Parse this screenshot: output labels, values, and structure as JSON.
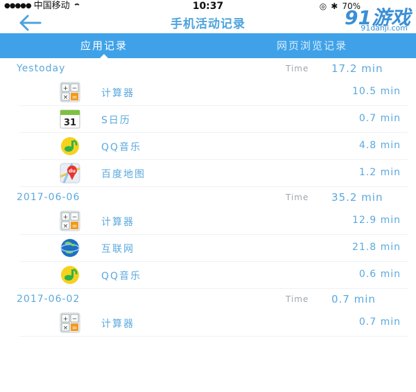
{
  "status_bar": {
    "carrier": "中国移动",
    "time": "10:37",
    "battery": "70%"
  },
  "navbar": {
    "title": "手机活动记录",
    "back_icon": "arrow-left-icon",
    "watermark_big": "91游戏",
    "watermark_small": "91danji.com"
  },
  "tabs": [
    {
      "label": "应用记录",
      "active": true
    },
    {
      "label": "网页浏览记录",
      "active": false
    }
  ],
  "time_label": "Time",
  "groups": [
    {
      "date": "Yestoday",
      "total": "17.2 min",
      "items": [
        {
          "name": "计算器",
          "duration": "10.5 min",
          "icon": "calculator-icon"
        },
        {
          "name": "S日历",
          "duration": "0.7 min",
          "icon": "calendar-icon",
          "icon_text": "31"
        },
        {
          "name": "QQ音乐",
          "duration": "4.8 min",
          "icon": "qq-music-icon"
        },
        {
          "name": "百度地图",
          "duration": "1.2 min",
          "icon": "baidu-map-icon",
          "icon_text": "du"
        }
      ]
    },
    {
      "date": "2017-06-06",
      "total": "35.2 min",
      "items": [
        {
          "name": "计算器",
          "duration": "12.9 min",
          "icon": "calculator-icon"
        },
        {
          "name": "互联网",
          "duration": "21.8 min",
          "icon": "globe-icon"
        },
        {
          "name": "QQ音乐",
          "duration": "0.6 min",
          "icon": "qq-music-icon"
        }
      ]
    },
    {
      "date": "2017-06-02",
      "total": "0.7 min",
      "items": [
        {
          "name": "计算器",
          "duration": "0.7 min",
          "icon": "calculator-icon"
        }
      ]
    }
  ],
  "colors": {
    "accent": "#3fa2e8",
    "text": "#5aa8de",
    "muted": "#9aa7b2"
  }
}
